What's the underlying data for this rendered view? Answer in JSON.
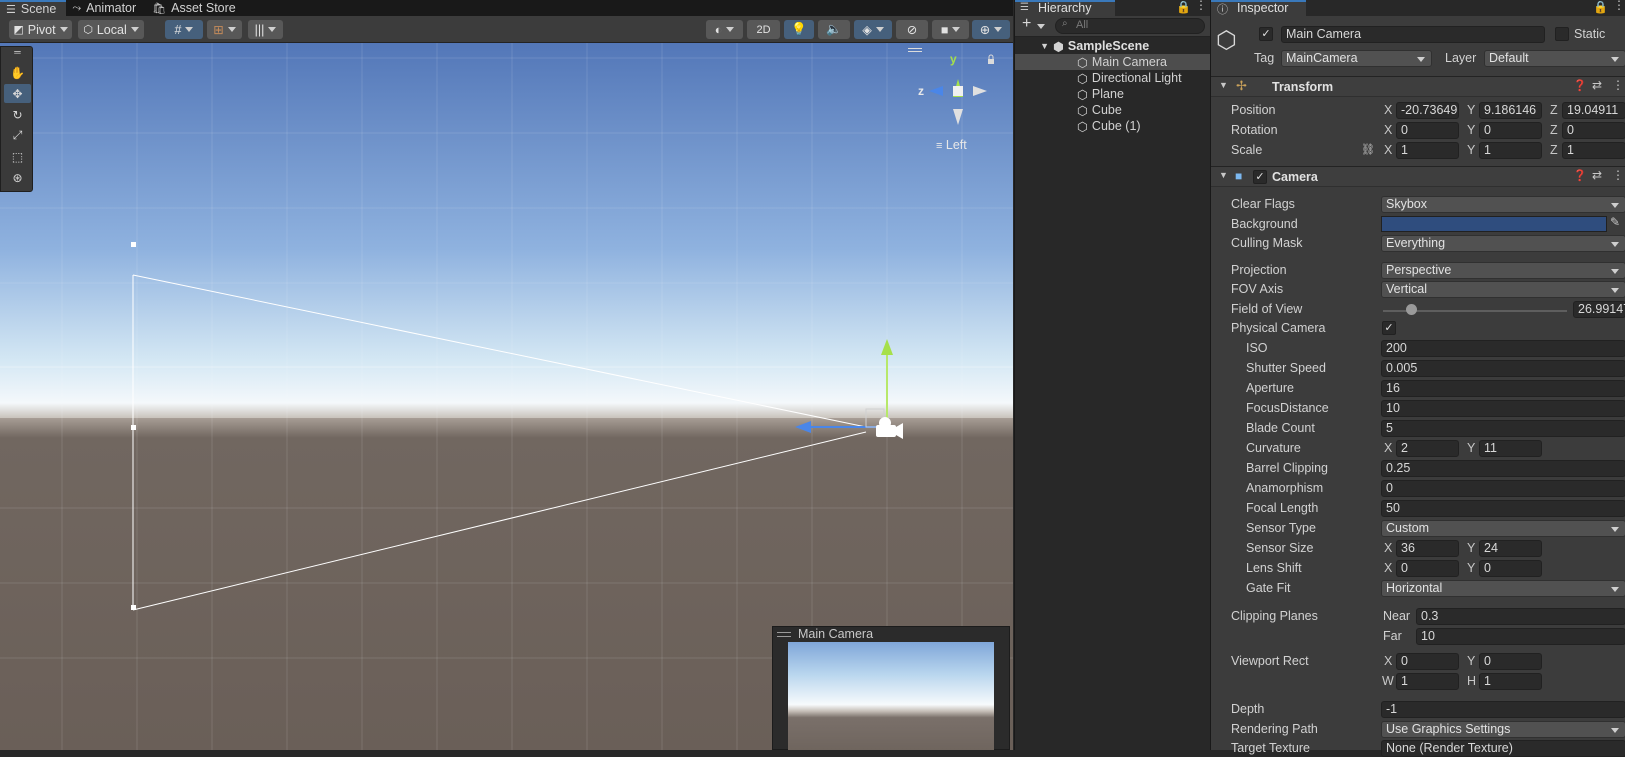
{
  "scene_tabs": [
    {
      "label": "Scene",
      "icon": "grid-icon"
    },
    {
      "label": "Animator",
      "icon": "animator-icon"
    },
    {
      "label": "Asset Store",
      "icon": "store-icon"
    }
  ],
  "scene_toolbar": {
    "pivot_label": "Pivot",
    "local_label": "Local",
    "mode_2d_label": "2D"
  },
  "gizmo": {
    "y_axis": "y",
    "z_axis": "z",
    "view_label": "Left"
  },
  "camera_preview": {
    "title": "Main Camera"
  },
  "hierarchy": {
    "tab": "Hierarchy",
    "search_placeholder": "All",
    "scene": "SampleScene",
    "items": [
      "Main Camera",
      "Directional Light",
      "Plane",
      "Cube",
      "Cube (1)"
    ],
    "selected_index": 0
  },
  "inspector": {
    "tab": "Inspector",
    "object_name": "Main Camera",
    "static_label": "Static",
    "tag_label": "Tag",
    "tag_value": "MainCamera",
    "layer_label": "Layer",
    "layer_value": "Default",
    "transform": {
      "title": "Transform",
      "position_label": "Position",
      "position": {
        "x": "-20.73649",
        "y": "9.186146",
        "z": "19.04911"
      },
      "rotation_label": "Rotation",
      "rotation": {
        "x": "0",
        "y": "0",
        "z": "0"
      },
      "scale_label": "Scale",
      "scale": {
        "x": "1",
        "y": "1",
        "z": "1"
      }
    },
    "camera": {
      "title": "Camera",
      "clear_flags_label": "Clear Flags",
      "clear_flags": "Skybox",
      "background_label": "Background",
      "background_color": "#2f4d7e",
      "culling_mask_label": "Culling Mask",
      "culling_mask": "Everything",
      "projection_label": "Projection",
      "projection": "Perspective",
      "fov_axis_label": "FOV Axis",
      "fov_axis": "Vertical",
      "fov_label": "Field of View",
      "fov_value": "26.99147",
      "fov_slider_fraction": 0.15,
      "physical_label": "Physical Camera",
      "iso_label": "ISO",
      "iso": "200",
      "shutter_label": "Shutter Speed",
      "shutter": "0.005",
      "aperture_label": "Aperture",
      "aperture": "16",
      "focus_label": "FocusDistance",
      "focus": "10",
      "blade_label": "Blade Count",
      "blade": "5",
      "curvature_label": "Curvature",
      "curvature": {
        "x": "2",
        "y": "11"
      },
      "barrel_label": "Barrel Clipping",
      "barrel": "0.25",
      "anamorphism_label": "Anamorphism",
      "anamorphism": "0",
      "focal_label": "Focal Length",
      "focal": "50",
      "sensor_type_label": "Sensor Type",
      "sensor_type": "Custom",
      "sensor_size_label": "Sensor Size",
      "sensor_size": {
        "x": "36",
        "y": "24"
      },
      "lens_shift_label": "Lens Shift",
      "lens_shift": {
        "x": "0",
        "y": "0"
      },
      "gate_fit_label": "Gate Fit",
      "gate_fit": "Horizontal",
      "clipping_label": "Clipping Planes",
      "near_label": "Near",
      "near": "0.3",
      "far_label": "Far",
      "far": "10",
      "viewport_label": "Viewport Rect",
      "viewport": {
        "x": "0",
        "y": "0",
        "w": "1",
        "h": "1"
      },
      "depth_label": "Depth",
      "depth": "-1",
      "rendering_path_label": "Rendering Path",
      "rendering_path": "Use Graphics Settings",
      "target_texture_label": "Target Texture",
      "target_texture": "None (Render Texture)"
    }
  }
}
